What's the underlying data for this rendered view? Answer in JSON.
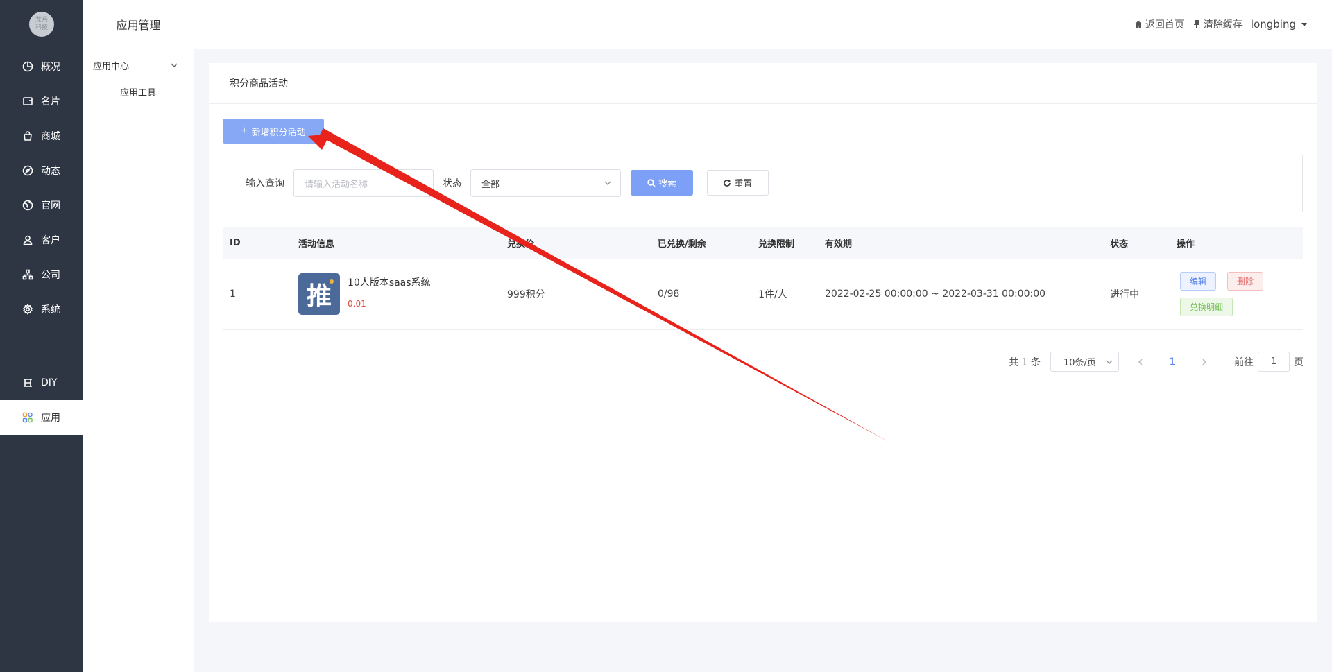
{
  "nav": {
    "logo_text": "龙兵\n科技",
    "items": [
      {
        "label": "概况",
        "icon": "pie-chart-icon"
      },
      {
        "label": "名片",
        "icon": "card-icon"
      },
      {
        "label": "商城",
        "icon": "bag-icon"
      },
      {
        "label": "动态",
        "icon": "compass-icon"
      },
      {
        "label": "官网",
        "icon": "globe-icon"
      },
      {
        "label": "客户",
        "icon": "user-icon"
      },
      {
        "label": "公司",
        "icon": "org-icon"
      },
      {
        "label": "系统",
        "icon": "gear-icon"
      },
      {
        "label": "DIY",
        "icon": "layout-icon"
      },
      {
        "label": "应用",
        "icon": "apps-icon",
        "active": true
      }
    ]
  },
  "sub": {
    "title": "应用管理",
    "group": "应用中心",
    "item": "应用工具"
  },
  "topbar": {
    "home": "返回首页",
    "clear_cache": "清除缓存",
    "user": "longbing"
  },
  "card": {
    "title": "积分商品活动",
    "add_button": "新增积分活动",
    "filter": {
      "query_label": "输入查询",
      "query_placeholder": "请输入活动名称",
      "status_label": "状态",
      "status_value": "全部",
      "search": "搜索",
      "reset": "重置"
    },
    "table": {
      "headers": [
        "ID",
        "活动信息",
        "兑换价",
        "已兑换/剩余",
        "兑换限制",
        "有效期",
        "状态",
        "操作"
      ],
      "rows": [
        {
          "id": "1",
          "thumb_char": "推",
          "name": "10人版本saas系统",
          "price": "0.01",
          "points": "999积分",
          "redeemed": "0/98",
          "limit": "1件/人",
          "period": "2022-02-25 00:00:00 ~ 2022-03-31 00:00:00",
          "status": "进行中",
          "ops": {
            "edit": "编辑",
            "delete": "删除",
            "detail": "兑换明细"
          }
        }
      ]
    },
    "pager": {
      "total": "共 1 条",
      "size": "10条/页",
      "current": "1",
      "goto_prefix": "前往",
      "goto_value": "1",
      "goto_suffix": "页"
    }
  },
  "colors": {
    "sidebar": "#2e3543",
    "primary": "#7ca0f6",
    "danger": "#e56b6b",
    "success": "#73c155",
    "annotation_arrow": "#e8231c"
  }
}
